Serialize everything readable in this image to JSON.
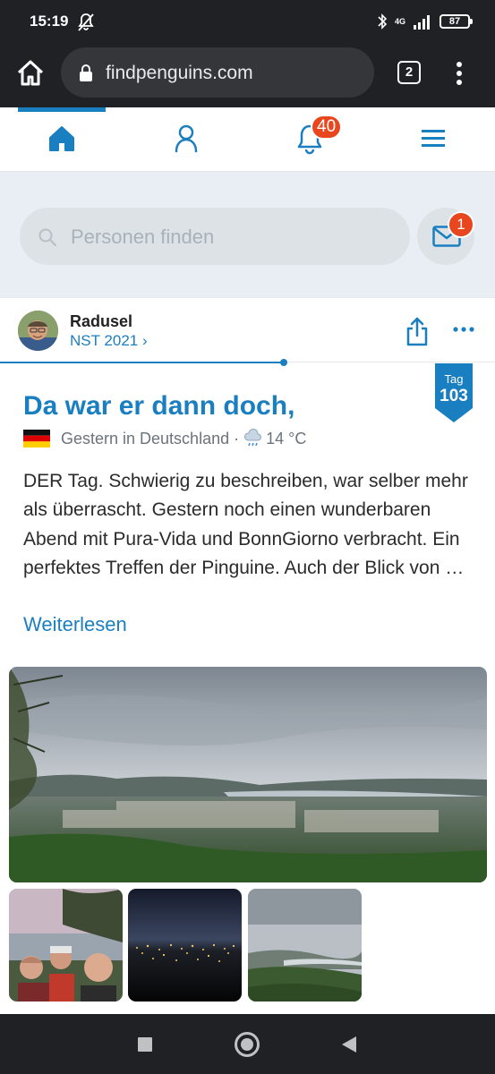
{
  "status_bar": {
    "time": "15:19",
    "network": "4G",
    "battery": "87",
    "icons": [
      "mute-icon",
      "bluetooth-icon",
      "signal-icon",
      "battery-icon"
    ]
  },
  "browser": {
    "url": "findpenguins.com",
    "tab_count": "2",
    "icons": [
      "home-icon",
      "lock-icon",
      "overflow-menu-icon"
    ]
  },
  "site_nav": {
    "items": [
      "home-icon",
      "profile-icon",
      "notifications-icon",
      "hamburger-menu-icon"
    ],
    "active": "home",
    "notification_count": "40",
    "accent_color": "#1a7fc1",
    "badge_color": "#e8461e"
  },
  "search": {
    "placeholder": "Personen finden",
    "message_count": "1"
  },
  "post": {
    "author": "Radusel",
    "trip": "NST 2021 ›",
    "day_label": "Tag",
    "day_number": "103",
    "title": "Da war er dann doch,",
    "date_location": "Gestern in Deutschland ·",
    "temperature": "14 °C",
    "text": "DER Tag. Schwierig zu beschreiben, war selber mehr als überrascht. Gestern noch einen wunderbaren Abend mit Pura-Vida und BonnGiorno verbracht. Ein perfektes Treffen der Pinguine. Auch der Blick von …",
    "read_more": "Weiterlesen",
    "photos": [
      "panorama-photo",
      "group-selfie-photo",
      "night-city-photo",
      "valley-view-photo"
    ]
  },
  "android_nav": [
    "recents-button",
    "home-button",
    "back-button"
  ]
}
